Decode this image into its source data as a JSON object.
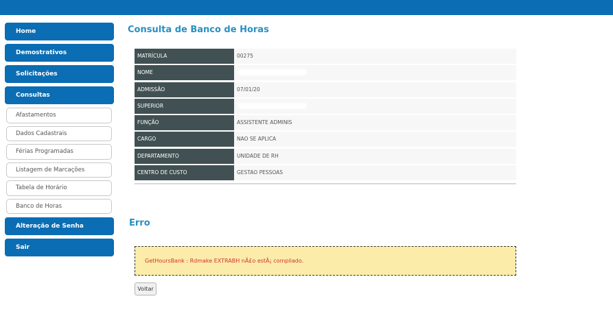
{
  "sidebar": {
    "menu_top": [
      "Home",
      "Demostrativos",
      "Solicitações",
      "Consultas"
    ],
    "submenu": [
      "Afastamentos",
      "Dados Cadastrais",
      "Férias Programadas",
      "Listagem de Marcações",
      "Tabela de Horário",
      "Banco de Horas"
    ],
    "menu_bottom": [
      "Alteração de Senha",
      "Sair"
    ]
  },
  "page": {
    "title": "Consulta de Banco de Horas"
  },
  "info": {
    "rows": [
      {
        "label": "MATRÍCULA",
        "value": "00275"
      },
      {
        "label": "NOME",
        "value": ""
      },
      {
        "label": "ADMISSÃO",
        "value": "07/01/20"
      },
      {
        "label": "SUPERIOR",
        "value": ""
      },
      {
        "label": "FUNÇÃO",
        "value": "ASSISTENTE ADMINIS"
      },
      {
        "label": "CARGO",
        "value": "NAO SE APLICA"
      },
      {
        "label": "DEPARTAMENTO",
        "value": "UNIDADE DE RH"
      },
      {
        "label": "CENTRO DE CUSTO",
        "value": "GESTAO PESSOAS"
      }
    ]
  },
  "error": {
    "title": "Erro",
    "message": "GetHoursBank : Rdmake EXTRABH nÃ£o estÃ¡ compilado."
  },
  "buttons": {
    "back": "Voltar"
  },
  "colors": {
    "primary": "#0b6db3",
    "title": "#2a8fc2",
    "label_bg": "#415053",
    "error_bg": "#fbeda9",
    "error_text": "#d42f2f"
  }
}
